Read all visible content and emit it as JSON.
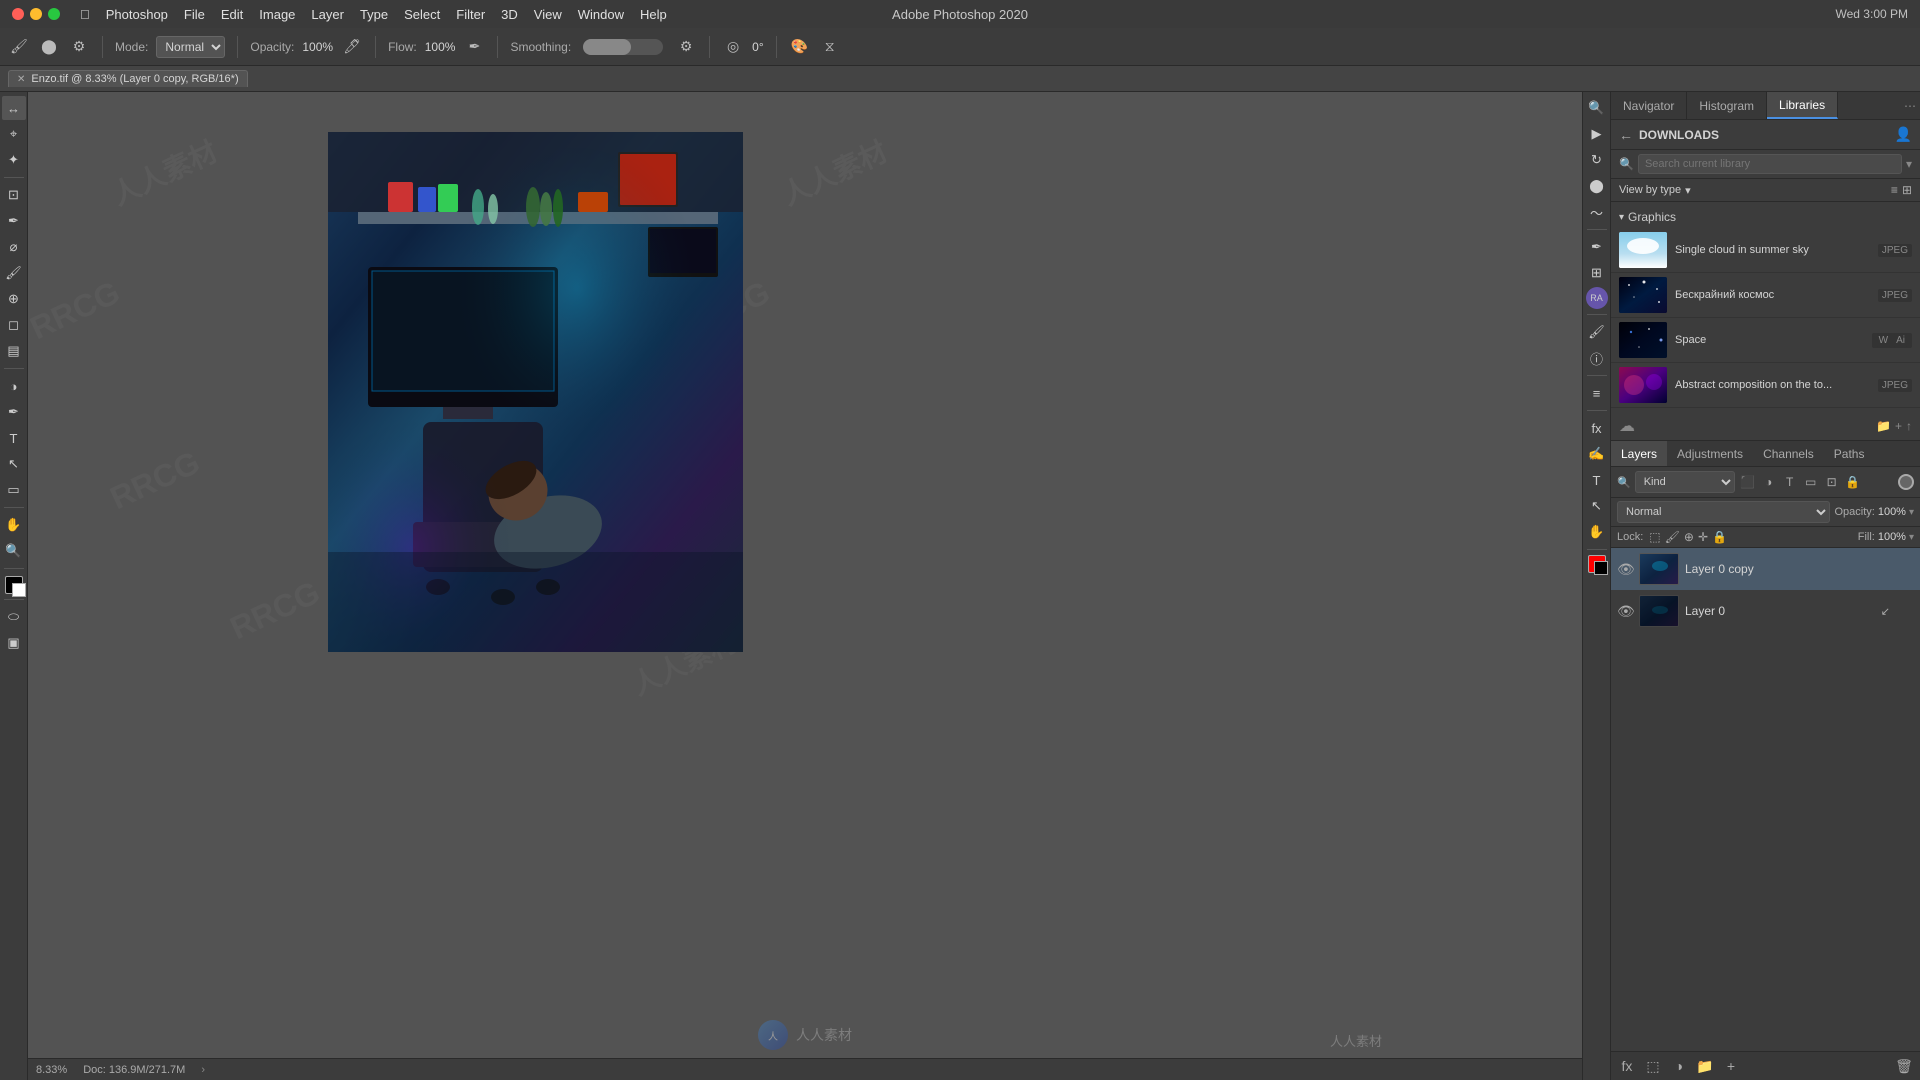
{
  "titlebar": {
    "app_name": "Adobe Photoshop 2020",
    "menu_items": [
      "Apple",
      "Photoshop",
      "File",
      "Edit",
      "Image",
      "Layer",
      "Type",
      "Select",
      "Filter",
      "3D",
      "View",
      "Window",
      "Help"
    ],
    "time": "Wed 3:00 PM"
  },
  "options_bar": {
    "mode_label": "Mode:",
    "mode_value": "Normal",
    "opacity_label": "Opacity:",
    "opacity_value": "100%",
    "flow_label": "Flow:",
    "flow_value": "100%",
    "smoothing_label": "Smoothing:",
    "angle_value": "0°"
  },
  "doc_tab": {
    "title": "Enzo.tif @ 8.33% (Layer 0 copy, RGB/16*)"
  },
  "canvas": {
    "watermarks": [
      "人人素材",
      "RRCG",
      "人人素材",
      "RRCG"
    ]
  },
  "status_bar": {
    "zoom": "8.33%",
    "doc_info": "Doc: 136.9M/271.7M",
    "watermark": "人人素材"
  },
  "libraries_panel": {
    "tabs": [
      "Navigator",
      "Histogram",
      "Libraries"
    ],
    "active_tab": "Libraries",
    "back_label": "DOWNLOADS",
    "search_placeholder": "Search current library",
    "view_by_type_label": "View by type",
    "graphics_section": "Graphics",
    "items": [
      {
        "name": "Single cloud in summer sky",
        "badge": "JPEG",
        "thumb": "sky"
      },
      {
        "name": "Бескрайний космос",
        "badge": "JPEG",
        "thumb": "space"
      },
      {
        "name": "Space",
        "badge": "Ai",
        "thumb": "space2"
      },
      {
        "name": "Abstract composition on the to...",
        "badge": "JPEG",
        "thumb": "abstract"
      }
    ]
  },
  "layers_panel": {
    "tabs": [
      "Layers",
      "Adjustments",
      "Channels",
      "Paths"
    ],
    "active_tab": "Layers",
    "kind_label": "Kind",
    "blend_mode": "Normal",
    "opacity_label": "Opacity:",
    "opacity_value": "100%",
    "lock_label": "Lock:",
    "fill_label": "Fill:",
    "fill_value": "100%",
    "layers": [
      {
        "name": "Layer 0 copy",
        "thumb": "copy",
        "visible": true,
        "selected": true
      },
      {
        "name": "Layer 0",
        "thumb": "base",
        "visible": true,
        "selected": false
      }
    ]
  },
  "right_toolbar": {
    "tools": [
      "zoom",
      "hand",
      "color",
      "history",
      "layers",
      "info",
      "char",
      "text",
      "move",
      "brush"
    ]
  }
}
